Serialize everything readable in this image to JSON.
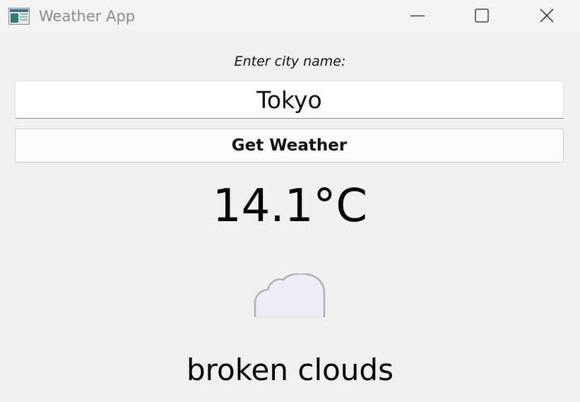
{
  "window": {
    "title": "Weather App",
    "app_icon": "weather-app-icon",
    "controls": [
      "minimize-icon",
      "maximize-icon",
      "close-icon"
    ]
  },
  "form": {
    "label": "Enter city name:",
    "city_value": "Tokyo",
    "button_label": "Get Weather"
  },
  "weather": {
    "temperature": "14.1°C",
    "icon": "cloud-icon",
    "description": "broken clouds"
  },
  "colors": {
    "background": "#f0f0f0",
    "cloud_fill": "#f0ecf7",
    "cloud_outline": "#b4afbc"
  }
}
